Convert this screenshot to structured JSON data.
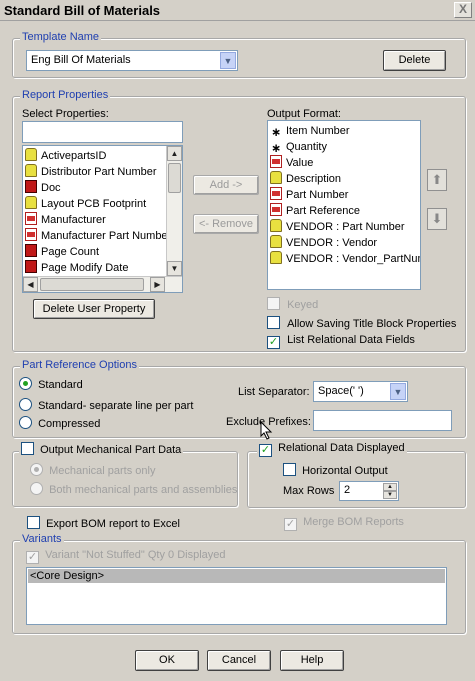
{
  "window": {
    "title": "Standard Bill of Materials",
    "close_label": "X"
  },
  "template": {
    "legend": "Template Name",
    "selected": "Eng Bill Of Materials",
    "delete_label": "Delete"
  },
  "report": {
    "legend": "Report Properties",
    "select_label": "Select Properties:",
    "output_label": "Output Format:",
    "select_items": [
      {
        "label": "ActivepartsID",
        "icon": "yellow"
      },
      {
        "label": "Distributor Part Number",
        "icon": "yellow"
      },
      {
        "label": "Doc",
        "icon": "chip"
      },
      {
        "label": "Layout PCB Footprint",
        "icon": "yellow"
      },
      {
        "label": "Manufacturer",
        "icon": "red"
      },
      {
        "label": "Manufacturer Part Numbe",
        "icon": "red"
      },
      {
        "label": "Page Count",
        "icon": "chip"
      },
      {
        "label": "Page Modify Date",
        "icon": "chip"
      }
    ],
    "output_items": [
      {
        "label": "Item Number",
        "icon": "star"
      },
      {
        "label": "Quantity",
        "icon": "star"
      },
      {
        "label": "Value",
        "icon": "red"
      },
      {
        "label": "Description",
        "icon": "yellow"
      },
      {
        "label": "Part Number",
        "icon": "red"
      },
      {
        "label": "Part Reference",
        "icon": "red"
      },
      {
        "label": "VENDOR : Part Number",
        "icon": "yellow"
      },
      {
        "label": "VENDOR : Vendor",
        "icon": "yellow"
      },
      {
        "label": "VENDOR : Vendor_PartNum",
        "icon": "yellow"
      }
    ],
    "add_label": "Add ->",
    "remove_label": "<- Remove",
    "delete_user_property_label": "Delete User Property",
    "keyed_label": "Keyed",
    "allow_saving_label": "Allow Saving Title Block Properties",
    "list_relational_label": "List Relational Data Fields",
    "keyed_checked": false,
    "allow_saving_checked": false,
    "list_relational_checked": true
  },
  "part_ref": {
    "legend": "Part Reference Options",
    "options": [
      "Standard",
      "Standard- separate line per part",
      "Compressed"
    ],
    "selected_index": 0,
    "list_separator_label": "List Separator:",
    "list_separator_value": "Space(' ')",
    "exclude_prefixes_label": "Exclude Prefixes:",
    "exclude_prefixes_value": ""
  },
  "mechanical": {
    "output_label": "Output Mechanical Part Data",
    "checked": false,
    "only_label": "Mechanical parts only",
    "both_label": "Both mechanical parts and assemblies"
  },
  "relational": {
    "displayed_label": "Relational Data Displayed",
    "displayed_checked": true,
    "horizontal_label": "Horizontal Output",
    "horizontal_checked": false,
    "max_rows_label": "Max Rows",
    "max_rows_value": "2"
  },
  "export_excel_label": "Export BOM report to Excel",
  "merge_label": "Merge BOM Reports",
  "merge_checked": true,
  "variants": {
    "legend": "Variants",
    "not_stuffed_label": "Variant \"Not Stuffed\" Qty 0 Displayed",
    "not_stuffed_checked": true,
    "items": [
      "<Core Design>"
    ]
  },
  "footer": {
    "ok_label": "OK",
    "cancel_label": "Cancel",
    "help_label": "Help"
  },
  "colors": {
    "legend_text": "#1f3fb0",
    "check_mark": "#21a121",
    "selected_row": "#b8b8b8"
  }
}
